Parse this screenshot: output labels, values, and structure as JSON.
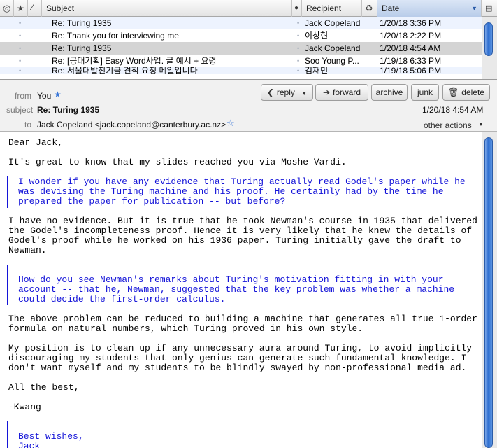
{
  "message_list": {
    "columns": {
      "subject": "Subject",
      "recipient": "Recipient",
      "date": "Date"
    },
    "rows": [
      {
        "subject": "Re: Turing 1935",
        "recipient": "Jack Copeland",
        "date": "1/20/18 3:36 PM"
      },
      {
        "subject": "Re: Thank you for interviewing me",
        "recipient": "이상현",
        "date": "1/20/18 2:22 PM"
      },
      {
        "subject": "Re: Turing 1935",
        "recipient": "Jack Copeland",
        "date": "1/20/18 4:54 AM"
      },
      {
        "subject": "Re: [공대기획] Easy Word사업. 글 예시 + 요령",
        "recipient": "Soo Young P...",
        "date": "1/19/18 6:33 PM"
      },
      {
        "subject": "Re: 서울대발전기금 견적 요청 메일입니다",
        "recipient": "김재민",
        "date": "1/19/18 5:06 PM"
      }
    ]
  },
  "header": {
    "from_label": "from",
    "from_value": "You",
    "subject_label": "subject",
    "subject_value": "Re: Turing 1935",
    "to_label": "to",
    "to_value": "Jack Copeland <jack.copeland@canterbury.ac.nz>",
    "date": "1/20/18 4:54 AM",
    "other_actions": "other actions",
    "buttons": {
      "reply": "reply",
      "forward": "forward",
      "archive": "archive",
      "junk": "junk",
      "delete": "delete"
    }
  },
  "body": {
    "greeting": "Dear Jack,",
    "p1": "It's great to know that my slides reached you via Moshe Vardi.",
    "q1": [
      "I wonder if you have any evidence that Turing actually read Godel's paper while he",
      "was devising the Turing machine and his proof. He certainly had by the time he",
      "prepared the paper for publication -- but before?"
    ],
    "p2": [
      "I have no evidence. But it is true that he took Newman's course in 1935 that delivered",
      "the Godel's incompleteness proof. Hence it is very likely that he knew the details of",
      "Godel's proof while he worked on his 1936 paper. Turing initially gave the draft to",
      "Newman."
    ],
    "q2": [
      "How do you see Newman's remarks about Turing's motivation fitting in with your",
      "account -- that he, Newman, suggested that the key problem was whether a machine",
      "could decide the first-order calculus."
    ],
    "p3": [
      "The above problem can be reduced to building a machine that generates all true 1-order",
      "formula on natural numbers, which Turing proved in his own style."
    ],
    "p4": [
      "My position is to clean up if any unnecessary aura around Turing, to avoid implicitly",
      "discouraging my students that only genius can generate such fundamental knowledge. I",
      "don't want myself and my students to be blindly swayed by non-professional media ad."
    ],
    "closing": "All the best,",
    "signature": "-Kwang",
    "q3": [
      "Best wishes,",
      "Jack"
    ]
  }
}
